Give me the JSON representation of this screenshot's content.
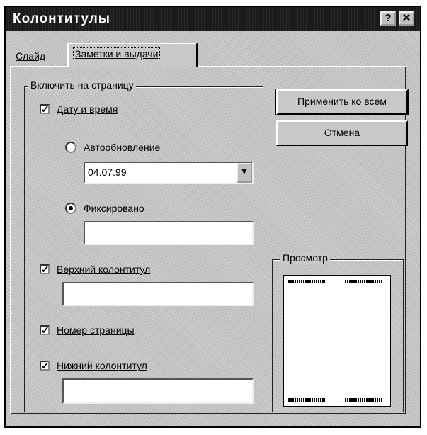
{
  "window": {
    "title": "Колонтитулы",
    "help_label": "?",
    "close_label": "✕"
  },
  "tabs": [
    {
      "label": "Слайд"
    },
    {
      "label": "Заметки и выдачи"
    }
  ],
  "include_group": {
    "legend": "Включить на страницу",
    "date_time": {
      "label": "Дату и время",
      "checked": true
    },
    "auto_update": {
      "label": "Автообновление",
      "selected": false
    },
    "date_value": "04.07.99",
    "fixed": {
      "label": "Фиксировано",
      "selected": true,
      "value": ""
    },
    "header": {
      "label": "Верхний колонтитул",
      "checked": true,
      "value": ""
    },
    "page_number": {
      "label": "Номер страницы",
      "checked": true
    },
    "footer": {
      "label": "Нижний колонтитул",
      "checked": true,
      "value": ""
    },
    "check_glyph": "✓",
    "dropdown_glyph": "▼"
  },
  "buttons": {
    "apply_all": "Применить ко всем",
    "cancel": "Отмена"
  },
  "preview": {
    "legend": "Просмотр"
  }
}
